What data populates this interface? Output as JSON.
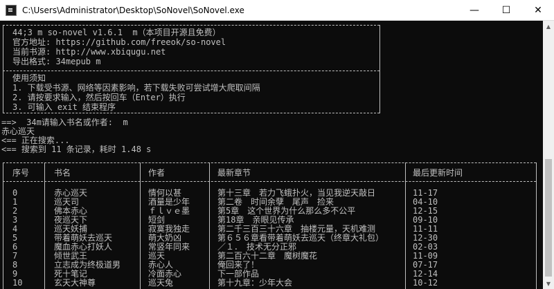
{
  "window": {
    "title": "C:\\Users\\Administrator\\Desktop\\SoNovel\\SoNovel.exe",
    "minimize": "—",
    "maximize": "☐",
    "close": "✕"
  },
  "info": {
    "line1": "44;3 m so-novel v1.6.1  m（本项目开源且免费）",
    "line2": "官方地址: https://github.com/freeok/so-novel",
    "line3": "当前书源: http://www.xbiqugu.net",
    "line4": "导出格式: 34mepub m"
  },
  "notice": {
    "title": "使用须知",
    "item1": "1. 下载受书源、网络等因素影响，若下载失败可尝试增大爬取间隔",
    "item2": "2. 请按要求输入，然后按回车（Enter）执行",
    "item3": "3. 可输入 exit 结束程序"
  },
  "prompt": "==>  34m请输入书名或作者:  m",
  "query": "赤心巡天",
  "status1": "<== 正在搜索...",
  "status2": "<== 搜索到 11 条记录，耗时 1.48 s",
  "table": {
    "headers": [
      "序号",
      "书名",
      "作者",
      "最新章节",
      "最后更新时间"
    ],
    "rows": [
      [
        "0",
        "赤心巡天",
        "情何以甚",
        "第十三章　若力飞蛾扑火，当见我逆天敲日",
        "11-17"
      ],
      [
        "1",
        "巡天司",
        "酒量是少年",
        "第二卷　时间余孽　尾声　捡来",
        "04-10"
      ],
      [
        "2",
        "佛本赤心",
        "ｆｌｖｅ墨",
        "第5章　这个世界为什么那么多不公平",
        "12-15"
      ],
      [
        "3",
        "夜巡天下",
        "短剑",
        "第18章　亲眼见传承",
        "09-10"
      ],
      [
        "4",
        "巡天妖捕",
        "寂寞我独走",
        "第二千三百三十六章　抽楼元量，天机难测",
        "11-11"
      ],
      [
        "5",
        "带着萌妖去巡天",
        "萌大奶凶",
        "第６５６章看带着萌妖去巡天（终章大礼包）",
        "12-30"
      ],
      [
        "6",
        "魔血赤心打妖人",
        "常竖年同来",
        "／１．　技术无分正邪",
        "02-03"
      ],
      [
        "7",
        "倾世武王",
        "巡天",
        "第二百六十二章　魔树魔花",
        "11-09"
      ],
      [
        "8",
        "立志成为终极道男",
        "赤心人",
        "俺回来了！",
        "07-17"
      ],
      [
        "9",
        "死十笔记",
        "冷面赤心",
        "下一部作品",
        "12-14"
      ],
      [
        "10",
        "玄天大神尊",
        "巡天兔",
        "第十九章：少年大会",
        "10-12"
      ]
    ]
  }
}
